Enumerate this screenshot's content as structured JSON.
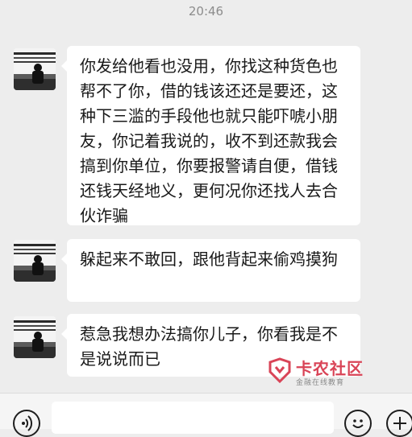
{
  "chat": {
    "timestamp": "20:46",
    "messages": [
      {
        "sender": "contact",
        "text": "你发给他看也没用，你找这种货色也帮不了你，借的钱该还还是要还，这种下三滥的手段他也就只能吓唬小朋友，你记着我说的，收不到还款我会搞到你单位，你要报警请自便，借钱还钱天经地义，更何况你还找人去合伙诈骗"
      },
      {
        "sender": "contact",
        "text": "躲起来不敢回，跟他背起来偷鸡摸狗"
      },
      {
        "sender": "contact",
        "text": "惹急我想办法搞你儿子，你看我是不是说说而已"
      }
    ]
  },
  "watermark": {
    "title": "卡农社区",
    "subtitle": "金融在线教育",
    "color": "#d94457"
  },
  "input_bar": {
    "voice_icon": "voice-icon",
    "emoji_icon": "emoji-icon",
    "plus_icon": "plus-icon"
  }
}
